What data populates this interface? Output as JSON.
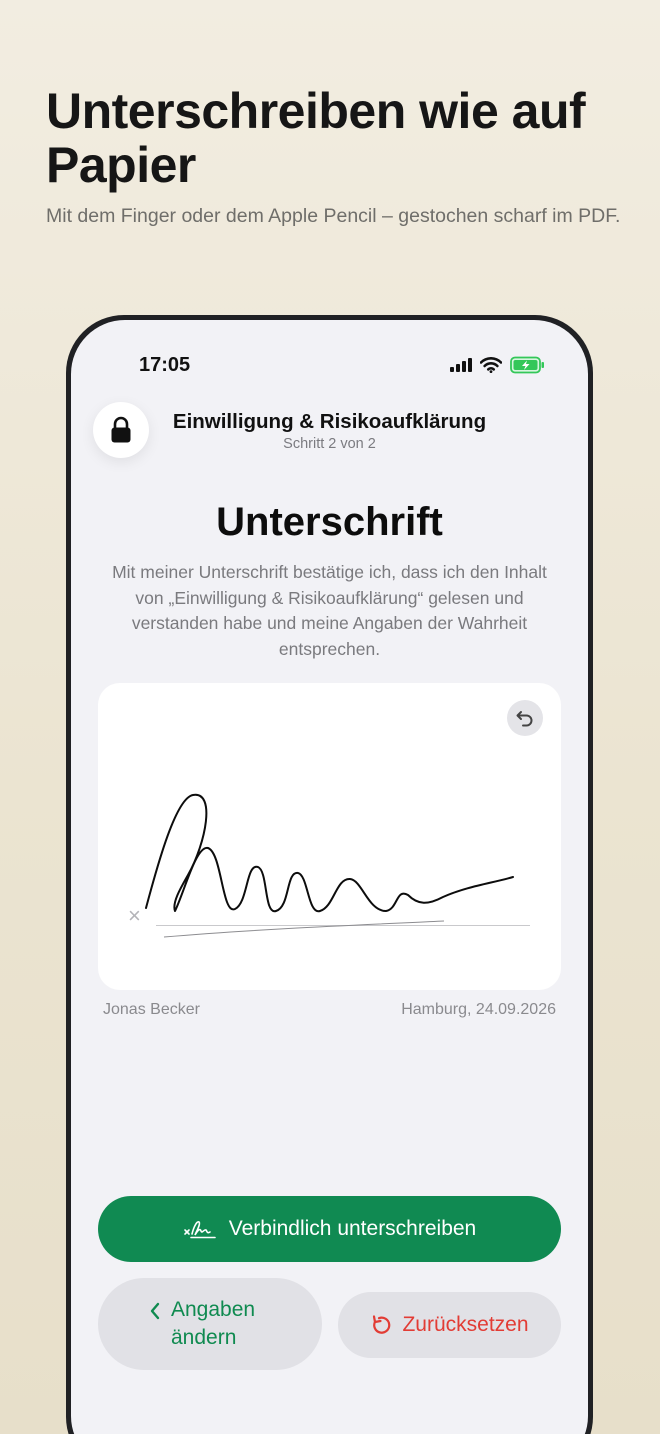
{
  "promo": {
    "headline": "Unterschreiben wie auf Papier",
    "subline": "Mit dem Finger oder dem Apple Pencil – gestochen scharf im PDF."
  },
  "status_bar": {
    "time": "17:05",
    "icons": [
      "cellular-signal-icon",
      "wifi-icon",
      "battery-charging-icon"
    ],
    "battery_color": "#34c759"
  },
  "nav": {
    "icon": "lock-icon",
    "title": "Einwilligung & Risikoaufklärung",
    "step": "Schritt 2 von 2"
  },
  "signature": {
    "title": "Unterschrift",
    "description": "Mit meiner Unterschrift bestätige ich, dass ich den Inhalt von „Einwilligung & Risikoaufklärung“ gelesen und verstanden habe und meine Angaben der Wahrheit entsprechen.",
    "pad_marker": "×",
    "undo_icon": "undo-icon",
    "signer_name": "Jonas Becker",
    "place_date": "Hamburg, 24.09.2026"
  },
  "actions": {
    "sign_label": "Verbindlich unterschreiben",
    "sign_icon": "signature-icon",
    "edit_label": "Angaben ändern",
    "edit_icon": "chevron-left-icon",
    "reset_label": "Zurücksetzen",
    "reset_icon": "reset-icon"
  },
  "colors": {
    "accent_green": "#108a52",
    "danger_red": "#e23c35",
    "background": "#f2f2f6"
  }
}
